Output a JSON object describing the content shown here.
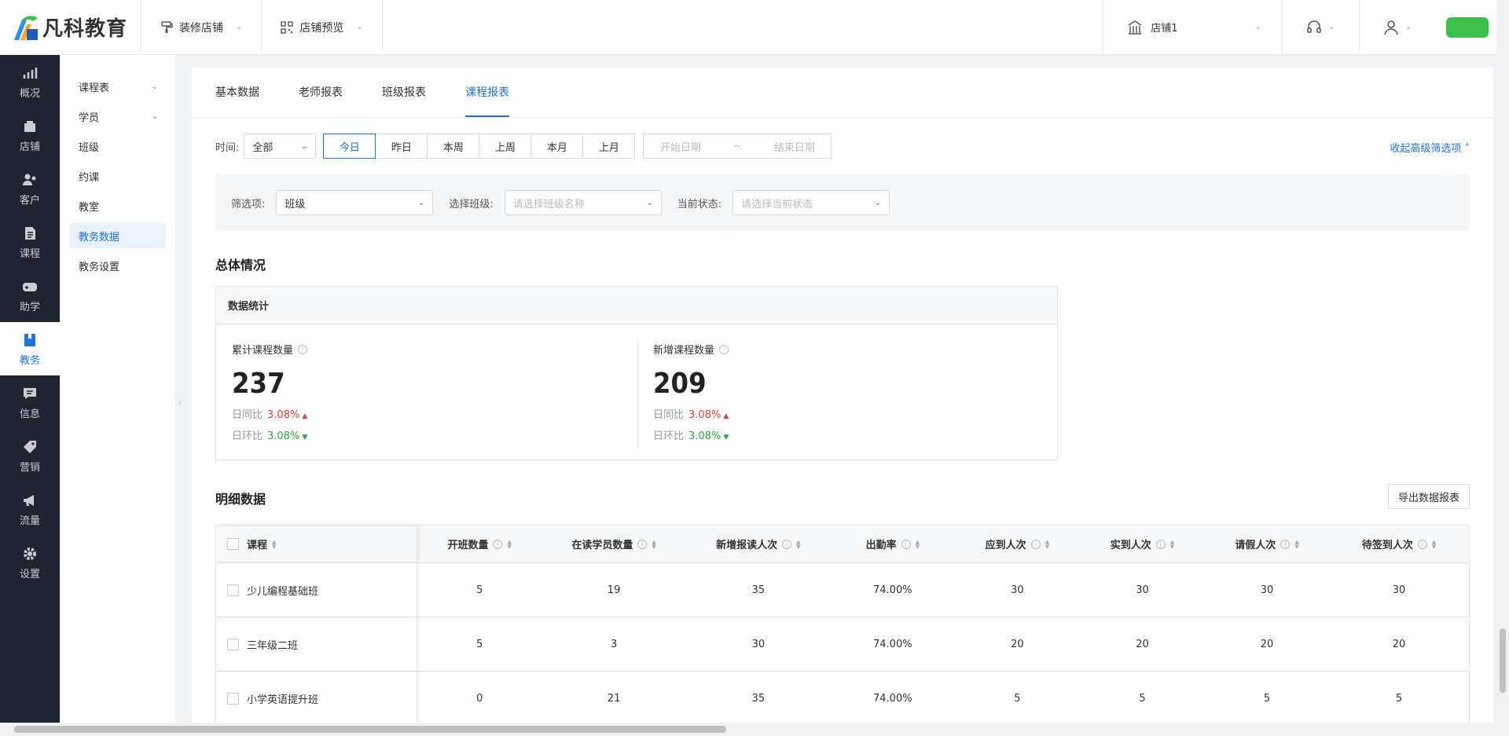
{
  "brand": {
    "name": "凡科教育"
  },
  "topbar": {
    "decorate": "装修店铺",
    "preview": "店铺预览",
    "store": "店铺1"
  },
  "rail": [
    {
      "label": "概况",
      "icon": "chart-icon"
    },
    {
      "label": "店铺",
      "icon": "store-icon"
    },
    {
      "label": "客户",
      "icon": "users-icon"
    },
    {
      "label": "课程",
      "icon": "document-icon"
    },
    {
      "label": "助学",
      "icon": "gamepad-icon"
    },
    {
      "label": "教务",
      "icon": "bookmark-icon"
    },
    {
      "label": "信息",
      "icon": "message-icon"
    },
    {
      "label": "营销",
      "icon": "tag-icon"
    },
    {
      "label": "流量",
      "icon": "megaphone-icon"
    },
    {
      "label": "设置",
      "icon": "gear-icon"
    }
  ],
  "subnav": [
    "课程表",
    "学员",
    "班级",
    "约课",
    "教室",
    "教务数据",
    "教务设置"
  ],
  "tabs": [
    "基本数据",
    "老师报表",
    "班级报表",
    "课程报表"
  ],
  "filters": {
    "time_label": "时间:",
    "time_select": "全部",
    "ranges": [
      "今日",
      "昨日",
      "本周",
      "上周",
      "本月",
      "上月"
    ],
    "start_ph": "开始日期",
    "tilde": "~",
    "end_ph": "结束日期",
    "advanced_toggle": "收起高级筛选项",
    "filter_label": "筛选项:",
    "filter_value": "班级",
    "class_label": "选择班级:",
    "class_ph": "请选择班级名称",
    "status_label": "当前状态:",
    "status_ph": "请选择当前状态"
  },
  "overview": {
    "title": "总体情况",
    "card_title": "数据统计",
    "stats": [
      {
        "title": "累计课程数量",
        "value": "237",
        "yoy_label": "日同比",
        "yoy": "3.08%",
        "mom_label": "日环比",
        "mom": "3.08%"
      },
      {
        "title": "新增课程数量",
        "value": "209",
        "yoy_label": "日同比",
        "yoy": "3.08%",
        "mom_label": "日环比",
        "mom": "3.08%"
      }
    ]
  },
  "detail": {
    "title": "明细数据",
    "export": "导出数据报表",
    "columns": [
      "课程",
      "开班数量",
      "在读学员数量",
      "新增报读人次",
      "出勤率",
      "应到人次",
      "实到人次",
      "请假人次",
      "待签到人次"
    ],
    "rows": [
      [
        "少儿编程基础班",
        "5",
        "19",
        "35",
        "74.00%",
        "30",
        "30",
        "30",
        "30"
      ],
      [
        "三年级二班",
        "5",
        "3",
        "30",
        "74.00%",
        "20",
        "20",
        "20",
        "20"
      ],
      [
        "小学英语提升班",
        "0",
        "21",
        "35",
        "74.00%",
        "5",
        "5",
        "5",
        "5"
      ]
    ]
  },
  "colors": {
    "accent": "#1e72d8",
    "rail_bg": "#1f2430",
    "up": "#e0433b",
    "down": "#2ea83a"
  }
}
